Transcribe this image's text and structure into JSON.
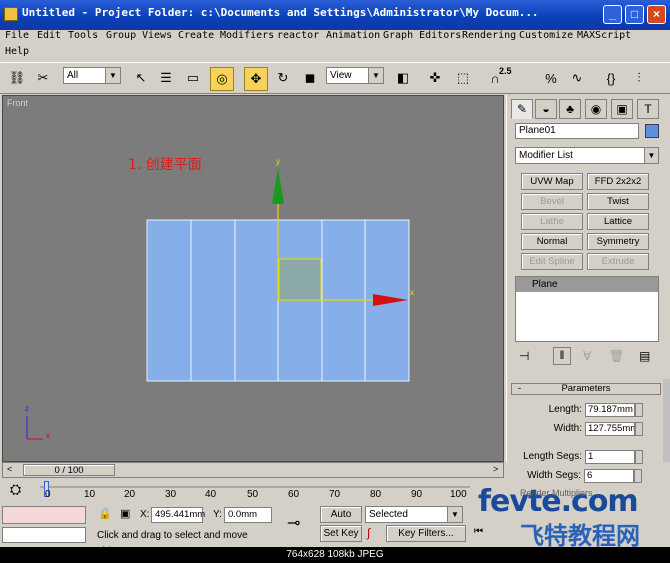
{
  "window": {
    "title": "Untitled      - Project Folder: c:\\Documents and Settings\\Administrator\\My Docum...",
    "min": "_",
    "max": "□",
    "close": "×"
  },
  "menu": [
    "File",
    "Edit",
    "Tools",
    "Group",
    "Views",
    "Create",
    "Modifiers",
    "reactor",
    "Animation",
    "Graph Editors",
    "Rendering",
    "Customize",
    "MAXScript",
    "Help"
  ],
  "toolbar": {
    "selection_filter": "All",
    "ref_coord": "View",
    "snap_label": "2.5"
  },
  "viewport": {
    "label": "Front",
    "annotation": "1. 创建平面",
    "axis_y": "y",
    "axis_x": "x",
    "corner_z": "z",
    "corner_x": "x"
  },
  "command_panel": {
    "object_name": "Plane01",
    "modifier_list": "Modifier List",
    "buttons": [
      "UVW Map",
      "FFD 2x2x2",
      "Bevel",
      "Twist",
      "Lathe",
      "Lattice",
      "Normal",
      "Symmetry",
      "Edit Spline",
      "Extrude"
    ],
    "stack_item": "Plane",
    "params_title": "Parameters",
    "length_label": "Length:",
    "length_value": "79.187mm",
    "width_label": "Width:",
    "width_value": "127.755mm",
    "length_segs_label": "Length Segs:",
    "length_segs_value": "1",
    "width_segs_label": "Width Segs:",
    "width_segs_value": "6",
    "render_mult_label": "Render Multipliers"
  },
  "timeline": {
    "frame_display": "0 / 100",
    "ticks": [
      "0",
      "10",
      "20",
      "30",
      "40",
      "50",
      "60",
      "70",
      "80",
      "90",
      "100"
    ]
  },
  "status": {
    "x_label": "X:",
    "x_value": "495.441mm",
    "y_label": "Y:",
    "y_value": "0.0mm",
    "auto_key": "Auto Key",
    "set_key": "Set Key",
    "selected": "Selected",
    "key_filters": "Key Filters...",
    "prompt": "Click and drag to select and move objects"
  },
  "footer": "764x628  108kb  JPEG",
  "watermark": "fevte.com",
  "watermark_cn": "飞特教程网"
}
